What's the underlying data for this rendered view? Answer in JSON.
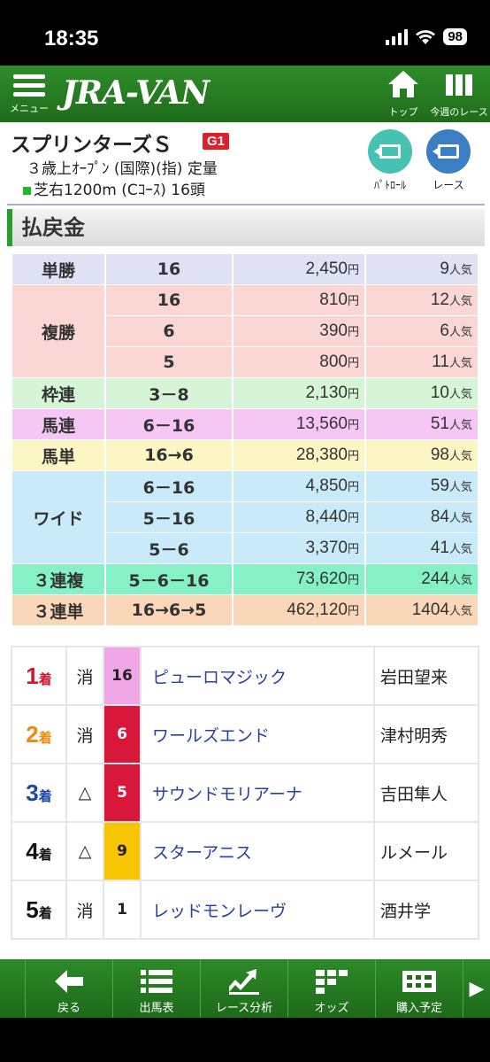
{
  "status": {
    "time": "18:35",
    "battery": "98"
  },
  "header": {
    "menu_label": "メニュー",
    "logo": "JRA-VAN",
    "top_label": "トップ",
    "week_label": "今週のレース"
  },
  "race": {
    "name": "スプリンターズＳ",
    "grade": "G1",
    "condition": "３歳上ｵｰﾌﾟﾝ (国際)(指) 定量",
    "course": "芝右1200m (Cｺｰｽ) 16頭",
    "patrol_label": "ﾊﾟﾄﾛｰﾙ",
    "race_video_label": "レース"
  },
  "section_title": "払戻金",
  "payouts": {
    "tansho": {
      "type": "単勝",
      "rows": [
        {
          "combo": "16",
          "amount": "2,450",
          "pop": "9"
        }
      ]
    },
    "fukusho": {
      "type": "複勝",
      "rows": [
        {
          "combo": "16",
          "amount": "810",
          "pop": "12"
        },
        {
          "combo": "6",
          "amount": "390",
          "pop": "6"
        },
        {
          "combo": "5",
          "amount": "800",
          "pop": "11"
        }
      ]
    },
    "wakuren": {
      "type": "枠連",
      "rows": [
        {
          "combo": "3－8",
          "amount": "2,130",
          "pop": "10"
        }
      ]
    },
    "umaren": {
      "type": "馬連",
      "rows": [
        {
          "combo": "6－16",
          "amount": "13,560",
          "pop": "51"
        }
      ]
    },
    "umatan": {
      "type": "馬単",
      "rows": [
        {
          "combo": "16→6",
          "amount": "28,380",
          "pop": "98"
        }
      ]
    },
    "wide": {
      "type": "ワイド",
      "rows": [
        {
          "combo": "6－16",
          "amount": "4,850",
          "pop": "59"
        },
        {
          "combo": "5－16",
          "amount": "8,440",
          "pop": "84"
        },
        {
          "combo": "5－6",
          "amount": "3,370",
          "pop": "41"
        }
      ]
    },
    "sanrenpuku": {
      "type": "３連複",
      "rows": [
        {
          "combo": "5－6－16",
          "amount": "73,620",
          "pop": "244"
        }
      ]
    },
    "sanrentan": {
      "type": "３連単",
      "rows": [
        {
          "combo": "16→6→5",
          "amount": "462,120",
          "pop": "1404"
        }
      ]
    },
    "yen_unit": "円",
    "pop_unit": "人気"
  },
  "results": {
    "rank_suffix": "着",
    "rows": [
      {
        "rank": "1",
        "mark": "消",
        "number": "16",
        "horse": "ピューロマジック",
        "jockey": "岩田望来",
        "rank_color": "#d4142a",
        "frame_color": "#f1a6e6",
        "num_color": "#222222"
      },
      {
        "rank": "2",
        "mark": "消",
        "number": "6",
        "horse": "ワールズエンド",
        "jockey": "津村明秀",
        "rank_color": "#ef8a12",
        "frame_color": "#d8183a",
        "num_color": "#ffffff"
      },
      {
        "rank": "3",
        "mark": "△",
        "number": "5",
        "horse": "サウンドモリアーナ",
        "jockey": "吉田隼人",
        "rank_color": "#1c46a8",
        "frame_color": "#d8183a",
        "num_color": "#ffffff"
      },
      {
        "rank": "4",
        "mark": "△",
        "number": "9",
        "horse": "スターアニス",
        "jockey": "ルメール",
        "rank_color": "#111111",
        "frame_color": "#f7c400",
        "num_color": "#222222"
      },
      {
        "rank": "5",
        "mark": "消",
        "number": "1",
        "horse": "レッドモンレーヴ",
        "jockey": "酒井学",
        "rank_color": "#111111",
        "frame_color": "#ffffff",
        "num_color": "#222222"
      }
    ]
  },
  "bottom_nav": {
    "back": "戻る",
    "entries": "出馬表",
    "analysis": "レース分析",
    "odds": "オッズ",
    "purchase": "購入予定"
  },
  "colors": {
    "brand_green": "#1e6d1a",
    "grade_red": "#e01f2d",
    "horse_link": "#2740a8"
  }
}
